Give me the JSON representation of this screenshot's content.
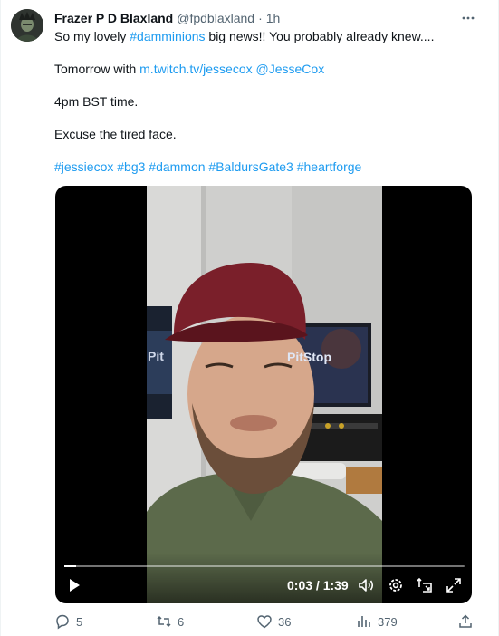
{
  "tweet": {
    "author_name": "Frazer P D Blaxland",
    "author_handle": "@fpdblaxland",
    "separator": "·",
    "time": "1h",
    "lines": {
      "line1_before": "So my lovely ",
      "line1_hashtag": "#damminions",
      "line1_after": " big news!! You probably already knew....",
      "line2_before": "Tomorrow with ",
      "line2_link": "m.twitch.tv/jessecox",
      "line2_space": " ",
      "line2_mention": "@JesseCox",
      "line3": "4pm BST time.",
      "line4": "Excuse the tired face.",
      "hashtags": "#jessiecox #bg3 #dammon #BaldursGate3 #heartforge"
    }
  },
  "video": {
    "time_readout": "0:03 / 1:39",
    "progress_fraction": 0.03,
    "screen_text": "PitStop",
    "screen_text_left": "Pit"
  },
  "actions": {
    "replies": "5",
    "reposts": "6",
    "likes": "36",
    "views": "379"
  },
  "colors": {
    "link": "#1d9bf0",
    "text": "#0f1419",
    "secondary": "#536471"
  },
  "icons": [
    "more-icon",
    "play-icon",
    "volume-icon",
    "settings-icon",
    "pip-icon",
    "fullscreen-icon",
    "reply-icon",
    "repost-icon",
    "like-icon",
    "views-icon",
    "share-icon"
  ]
}
